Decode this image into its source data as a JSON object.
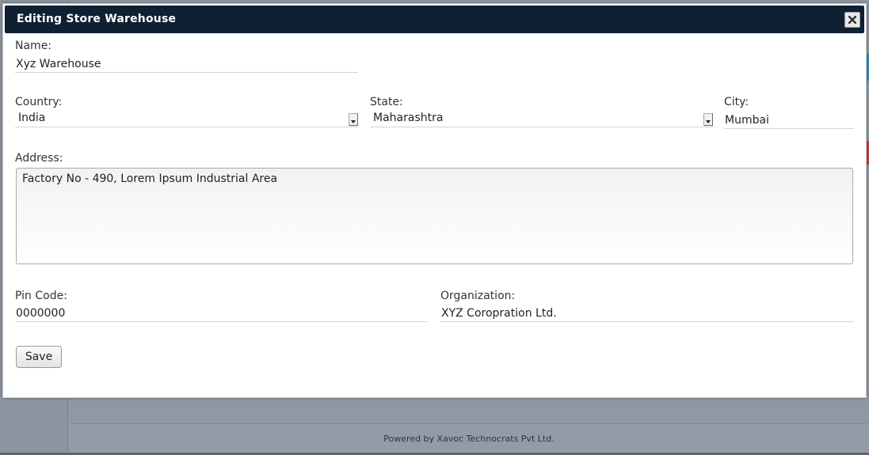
{
  "dialog": {
    "title": "Editing Store Warehouse",
    "close_icon": "close-icon"
  },
  "form": {
    "name": {
      "label": "Name:",
      "value": "Xyz Warehouse"
    },
    "country": {
      "label": "Country:",
      "value": "India"
    },
    "state": {
      "label": "State:",
      "value": "Maharashtra"
    },
    "city": {
      "label": "City:",
      "value": "Mumbai"
    },
    "address": {
      "label": "Address:",
      "value": "Factory No - 490, Lorem Ipsum Industrial Area"
    },
    "pin_code": {
      "label": "Pin Code:",
      "value": "0000000"
    },
    "organization": {
      "label": "Organization:",
      "value": "XYZ Coropration Ltd."
    },
    "save_label": "Save"
  },
  "background": {
    "footer_text": "Powered by Xavoc Technocrats Pvt Ltd."
  },
  "colors": {
    "titlebar": "#0f2033",
    "overlay": "#8e99a4"
  }
}
